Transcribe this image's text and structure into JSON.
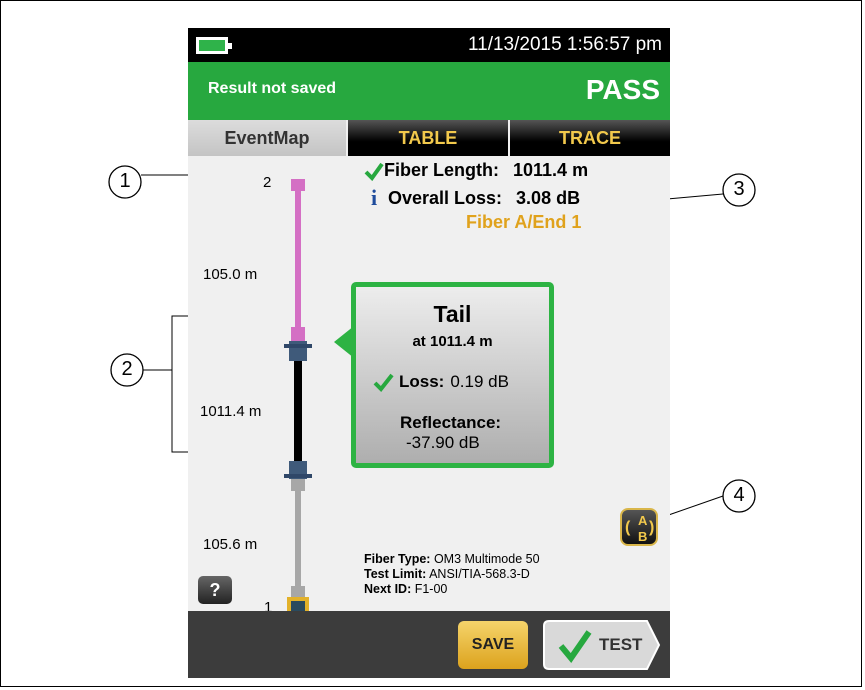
{
  "status_bar": {
    "datetime": "11/13/2015 1:56:57 pm",
    "battery_icon": "battery-icon"
  },
  "result_bar": {
    "status": "Result not saved",
    "verdict": "PASS",
    "color": "#27a83f"
  },
  "tabs": [
    {
      "label": "EventMap"
    },
    {
      "label": "TABLE"
    },
    {
      "label": "TRACE"
    }
  ],
  "summary": {
    "fiber_length_label": "Fiber Length:",
    "fiber_length_value": "1011.4 m",
    "overall_loss_label": "Overall Loss:",
    "overall_loss_value": "3.08 dB",
    "fiber_id": "Fiber A/End 1"
  },
  "event_map": {
    "top_connector_label": "2",
    "bottom_connector_label": "1",
    "segments": [
      {
        "length": "105.0 m",
        "color": "#d46fc4"
      },
      {
        "length": "1011.4 m",
        "color": "#000000"
      },
      {
        "length": "105.6 m",
        "color": "#a7a7a7"
      }
    ]
  },
  "popup": {
    "title": "Tail",
    "subtitle": "at 1011.4 m",
    "loss_label": "Loss:",
    "loss_value": "0.19 dB",
    "reflectance_label": "Reflectance:",
    "reflectance_value": "-37.90 dB",
    "accent": "#2db343"
  },
  "info": {
    "fiber_type_label": "Fiber Type:",
    "fiber_type_value": "OM3 Multimode 50",
    "test_limit_label": "Test Limit:",
    "test_limit_value": "ANSI/TIA-568.3-D",
    "next_id_label": "Next ID:",
    "next_id_value": "F1-00"
  },
  "buttons": {
    "help": "?",
    "save": "SAVE",
    "test": "TEST",
    "swap_a": "A",
    "swap_b": "B"
  },
  "callouts": [
    "1",
    "2",
    "3",
    "4"
  ]
}
